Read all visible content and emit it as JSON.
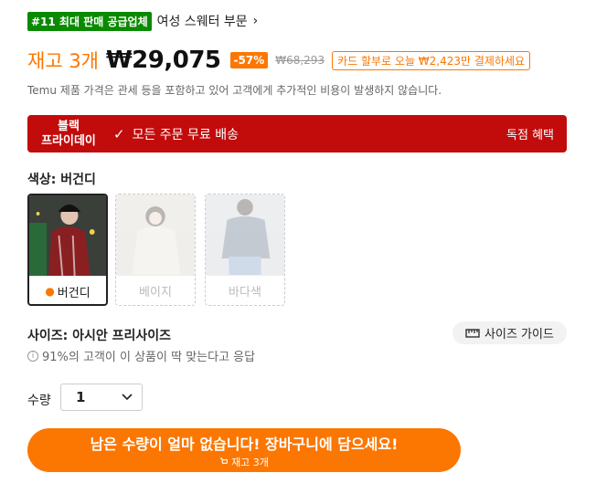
{
  "rank": {
    "badge": "#11 최대 판매 공급업체",
    "category": "여성 스웨터 부문",
    "chevron_icon": "chevron-right-icon"
  },
  "price": {
    "stock": "재고 3개",
    "current": "₩29,075",
    "discount": "-57%",
    "original": "₩68,293",
    "card_promo": "카드 할부로 오늘 ₩2,423만 결제하세요"
  },
  "disclaimer": "Temu 제품 가격은 관세 등을 포함하고 있어 고객에게 추가적인 비용이 발생하지 않습니다.",
  "black_prime": {
    "label": "블랙\n프라이데이",
    "check_icon": "check-icon",
    "text": "모든 주문 무료 배송",
    "perk": "독점 혜택",
    "color": "#c20b0b"
  },
  "color": {
    "label": "색상: 버건디",
    "options": [
      {
        "name": "버건디",
        "selected": true
      },
      {
        "name": "베이지",
        "selected": false
      },
      {
        "name": "바다색",
        "selected": false
      }
    ]
  },
  "size": {
    "label": "사이즈: 아시안 프리사이즈",
    "guide": "사이즈 가이드",
    "fit": "91%의 고객이 이 상품이 딱 맞는다고 응답",
    "guide_icon": "ruler-icon",
    "info_icon": "info-icon"
  },
  "quantity": {
    "label": "수량",
    "value": "1",
    "dropdown_icon": "chevron-down-icon"
  },
  "cta": {
    "main": "남은 수량이 얼마 없습니다! 장바구니에 담으세요!",
    "sub": "재고 3개",
    "color": "#fb7701"
  }
}
